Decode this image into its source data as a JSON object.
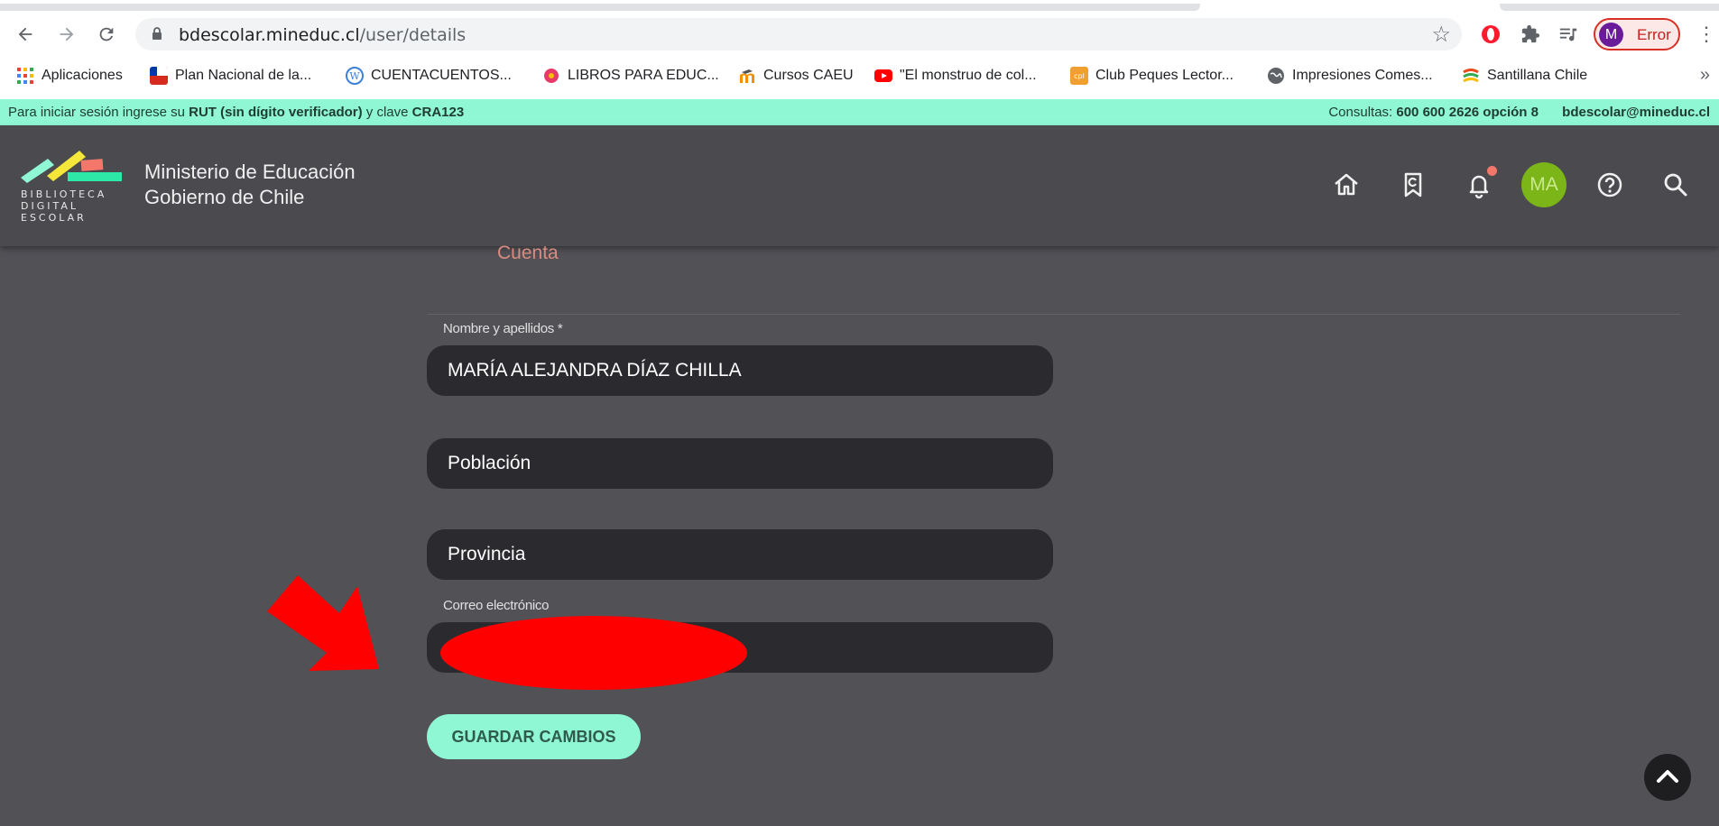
{
  "browser": {
    "url_host": "bdescolar.mineduc.cl",
    "url_path": "/user/details",
    "profile_initial": "M",
    "profile_status": "Error",
    "bookmarks": [
      {
        "label": "Aplicaciones",
        "icon": "apps-grid-icon",
        "color": "#4285f4"
      },
      {
        "label": "Plan Nacional de la...",
        "icon": "flag-icon",
        "color": "#1a56c7"
      },
      {
        "label": "CUENTACUENTOS...",
        "icon": "wordpress-icon",
        "color": "#3b82d6"
      },
      {
        "label": "LIBROS PARA EDUC...",
        "icon": "flower-icon",
        "color": "#e63a6a"
      },
      {
        "label": "Cursos CAEU",
        "icon": "moodle-icon",
        "color": "#f39200"
      },
      {
        "label": "\"El monstruo de col...",
        "icon": "youtube-icon",
        "color": "#ff0000"
      },
      {
        "label": "Club Peques Lector...",
        "icon": "club-icon",
        "color": "#f0a030"
      },
      {
        "label": "Impresiones Comes...",
        "icon": "globe-icon",
        "color": "#5f6368"
      },
      {
        "label": "Santillana Chile",
        "icon": "santillana-icon",
        "color": "#e84c1a"
      }
    ],
    "more": "»"
  },
  "notice": {
    "left_pre": "Para iniciar sesión ingrese su ",
    "left_rut": "RUT (sin dígito verificador)",
    "left_mid": " y clave ",
    "left_key": "CRA123",
    "right_pre": "Consultas: ",
    "right_phone": "600 600 2626 opción 8",
    "right_email": "bdescolar@mineduc.cl"
  },
  "header": {
    "logo_lines": [
      "BIBLIOTECA",
      "DIGITAL",
      "ESCOLAR"
    ],
    "ministry_line1": "Ministerio de Educación",
    "ministry_line2": "Gobierno de Chile",
    "avatar_initials": "MA"
  },
  "page": {
    "tab_label": "Cuenta",
    "name_label": "Nombre y apellidos *",
    "name_value": "MARÍA ALEJANDRA DÍAZ CHILLA",
    "poblacion_value": "Población",
    "provincia_value": "Provincia",
    "email_label": "Correo electrónico",
    "save_label": "GUARDAR CAMBIOS"
  },
  "colors": {
    "accent": "#8ff7d3",
    "page_bg": "#515156",
    "header_bg": "#4a4a4f",
    "field_bg": "#2b2b2f",
    "avatar": "#7cb518",
    "redaction": "#ff0000"
  }
}
